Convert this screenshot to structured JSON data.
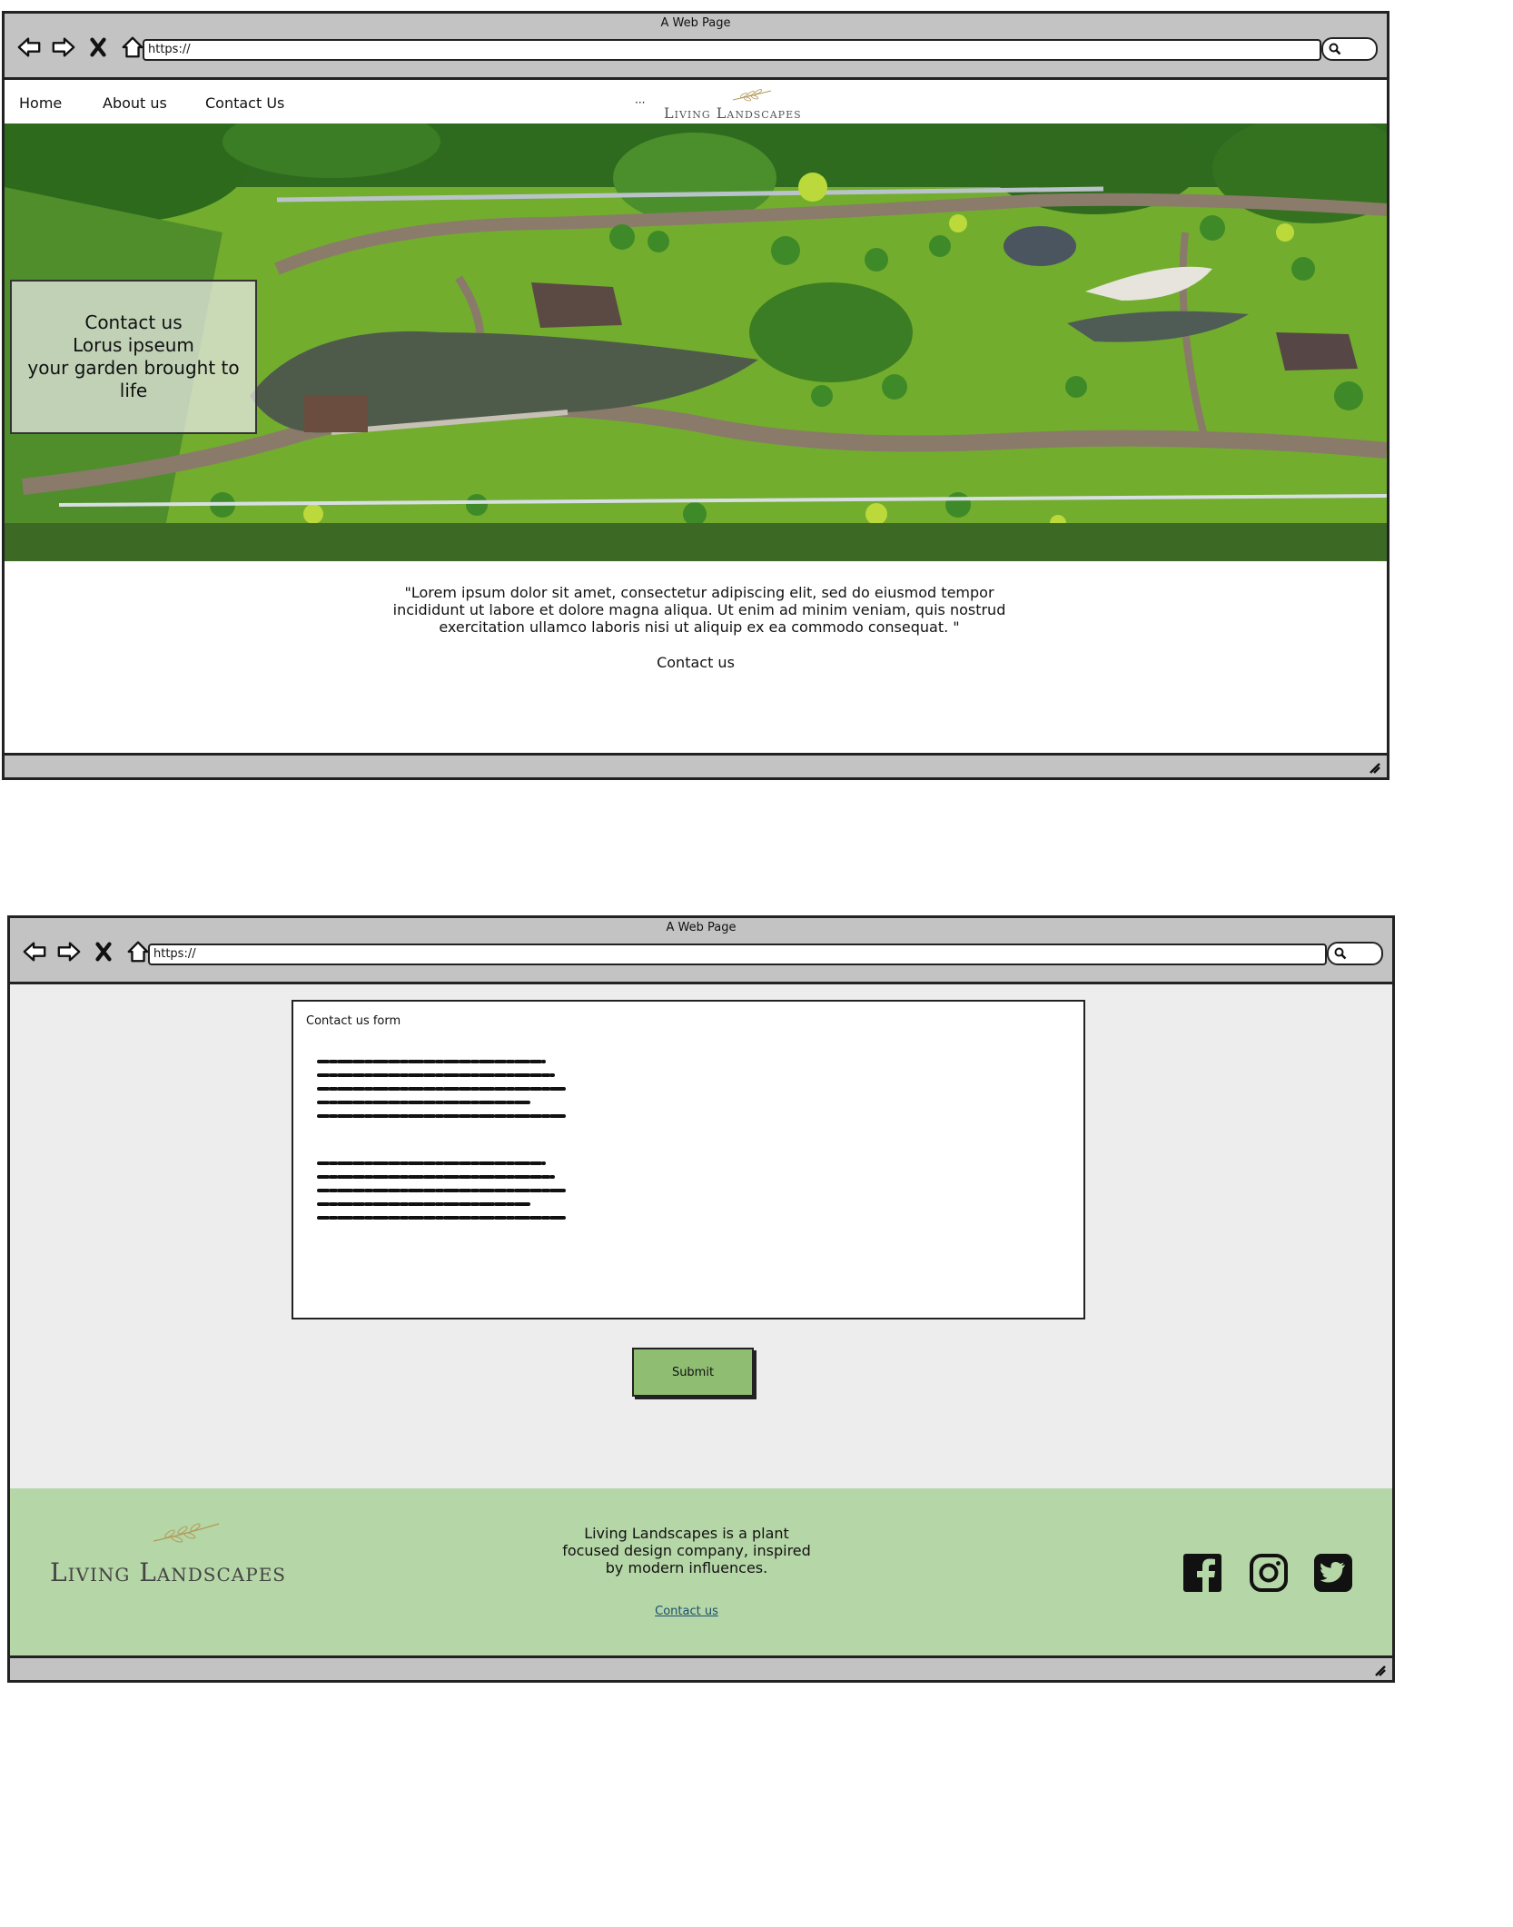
{
  "window1": {
    "title": "A Web Page",
    "url": "https://",
    "nav": {
      "home": "Home",
      "about": "About us",
      "contact": "Contact Us",
      "dots": "···"
    },
    "brand": "Living Landscapes",
    "hero": {
      "line1": "Contact us",
      "line2": "Lorus ipseum",
      "line3": "your garden brought to life"
    },
    "quote": "\"Lorem ipsum dolor sit amet, consectetur adipiscing elit, sed do eiusmod tempor incididunt ut labore et dolore magna aliqua. Ut enim ad minim veniam, quis nostrud exercitation ullamco laboris nisi ut aliquip ex ea commodo consequat. \"",
    "quote_link": "Contact us"
  },
  "window2": {
    "title": "A Web Page",
    "url": "https://",
    "form_title": "Contact us form",
    "submit_label": "Submit",
    "footer": {
      "brand": "Living Landscapes",
      "description": "Living Landscapes is a plant focused design company, inspired by modern influences.",
      "link": "Contact us",
      "social": [
        "facebook-icon",
        "instagram-icon",
        "twitter-icon"
      ]
    }
  },
  "colors": {
    "chrome": "#c3c3c3",
    "page_bg": "#ededed",
    "footer_bg": "#b5d6a6",
    "submit_bg": "#8fbe73",
    "link": "#1a4f6e"
  }
}
